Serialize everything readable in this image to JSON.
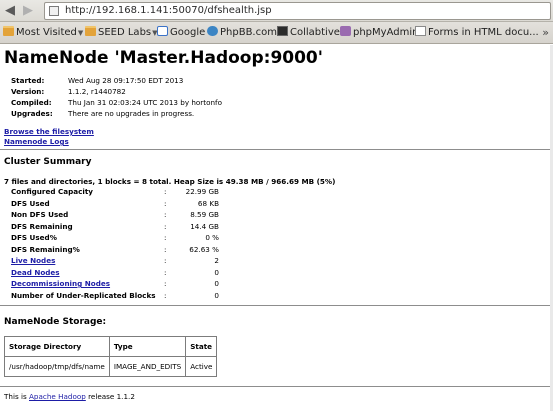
{
  "browser": {
    "url": "http://192.168.1.141:50070/dfshealth.jsp",
    "bookmarks": [
      "Most Visited",
      "SEED Labs",
      "Google",
      "PhpBB.com",
      "Collabtive",
      "phpMyAdmin",
      "Forms in HTML docu..."
    ]
  },
  "page": {
    "title": "NameNode 'Master.Hadoop:9000'",
    "info": [
      {
        "key": "Started:",
        "value": "Wed Aug 28 09:17:50 EDT 2013"
      },
      {
        "key": "Version:",
        "value": "1.1.2, r1440782"
      },
      {
        "key": "Compiled:",
        "value": "Thu Jan 31 02:03:24 UTC 2013 by hortonfo"
      },
      {
        "key": "Upgrades:",
        "value": "There are no upgrades in progress."
      }
    ],
    "links": [
      "Browse the filesystem",
      "Namenode Logs"
    ],
    "cluster_summary": {
      "heading": "Cluster Summary",
      "summary_line": "7 files and directories, 1 blocks = 8 total. Heap Size is 49.38 MB / 966.69 MB (5%)",
      "rows": [
        {
          "key": "Configured Capacity",
          "value": "22.99 GB",
          "link": false
        },
        {
          "key": "DFS Used",
          "value": "68 KB",
          "link": false
        },
        {
          "key": "Non DFS Used",
          "value": "8.59 GB",
          "link": false
        },
        {
          "key": "DFS Remaining",
          "value": "14.4 GB",
          "link": false
        },
        {
          "key": "DFS Used%",
          "value": "0 %",
          "link": false
        },
        {
          "key": "DFS Remaining%",
          "value": "62.63 %",
          "link": false
        },
        {
          "key": "Live Nodes",
          "value": "2",
          "link": true
        },
        {
          "key": "Dead Nodes",
          "value": "0",
          "link": true
        },
        {
          "key": "Decommissioning Nodes",
          "value": "0",
          "link": true
        },
        {
          "key": "Number of Under-Replicated Blocks",
          "value": "0",
          "link": false
        }
      ],
      "separator": ":"
    },
    "storage": {
      "heading": "NameNode Storage:",
      "headers": [
        "Storage Directory",
        "Type",
        "State"
      ],
      "rows": [
        [
          "/usr/hadoop/tmp/dfs/name",
          "IMAGE_AND_EDITS",
          "Active"
        ]
      ]
    },
    "footer": {
      "prefix": "This is ",
      "link": "Apache Hadoop",
      "suffix": " release 1.1.2"
    }
  }
}
